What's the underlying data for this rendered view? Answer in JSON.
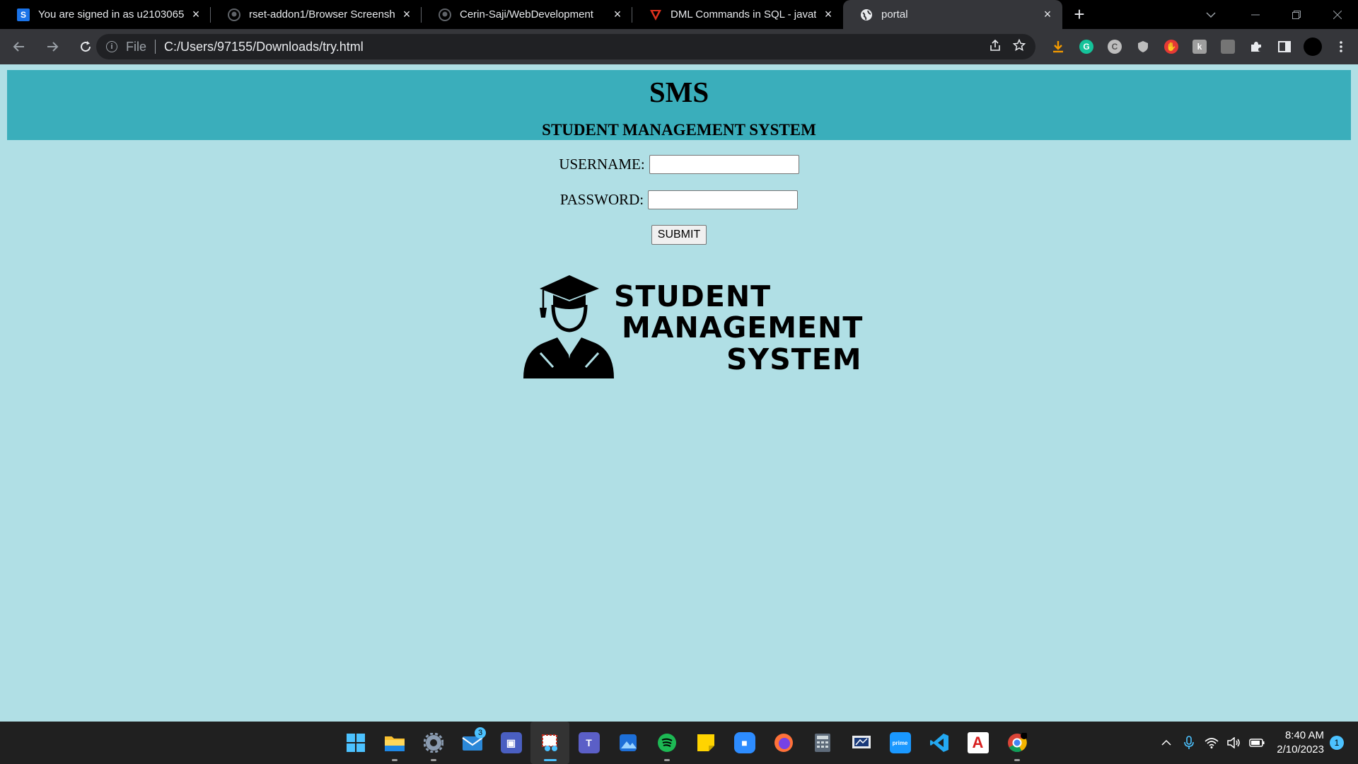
{
  "browser": {
    "tabs": [
      {
        "title": "You are signed in as u2103065",
        "favicon": "S",
        "favicon_color": "#1a73e8",
        "active": false
      },
      {
        "title": "rset-addon1/Browser Screenshot",
        "favicon": "github-icon",
        "favicon_color": "#5f6368",
        "active": false
      },
      {
        "title": "Cerin-Saji/WebDevelopment",
        "favicon": "github-icon",
        "favicon_color": "#5f6368",
        "active": false
      },
      {
        "title": "DML Commands in SQL - javatpoint",
        "favicon": "javatpoint-icon",
        "favicon_color": "#e0311e",
        "active": false
      },
      {
        "title": "portal",
        "favicon": "globe-icon",
        "favicon_color": "#e8eaed",
        "active": true
      }
    ],
    "omnibox": {
      "scheme": "File",
      "url": "C:/Users/97155/Downloads/try.html"
    }
  },
  "page": {
    "title": "SMS",
    "subtitle": "STUDENT MANAGEMENT SYSTEM",
    "form": {
      "username_label": "USERNAME:",
      "password_label": "PASSWORD:",
      "username_value": "",
      "password_value": "",
      "submit_label": "SUBMIT"
    },
    "logo": {
      "line1": "STUDENT",
      "line2": "MANAGEMENT",
      "line3": "SYSTEM"
    }
  },
  "taskbar": {
    "mail_badge": "3",
    "time": "8:40 AM",
    "date": "2/10/2023",
    "notification_count": "1"
  },
  "colors": {
    "page_bg": "#b0dfe5",
    "header_bg": "#3aaebb",
    "browser_frame": "#000000",
    "toolbar": "#35363a",
    "taskbar": "#202020",
    "accent": "#4cc2ff"
  }
}
